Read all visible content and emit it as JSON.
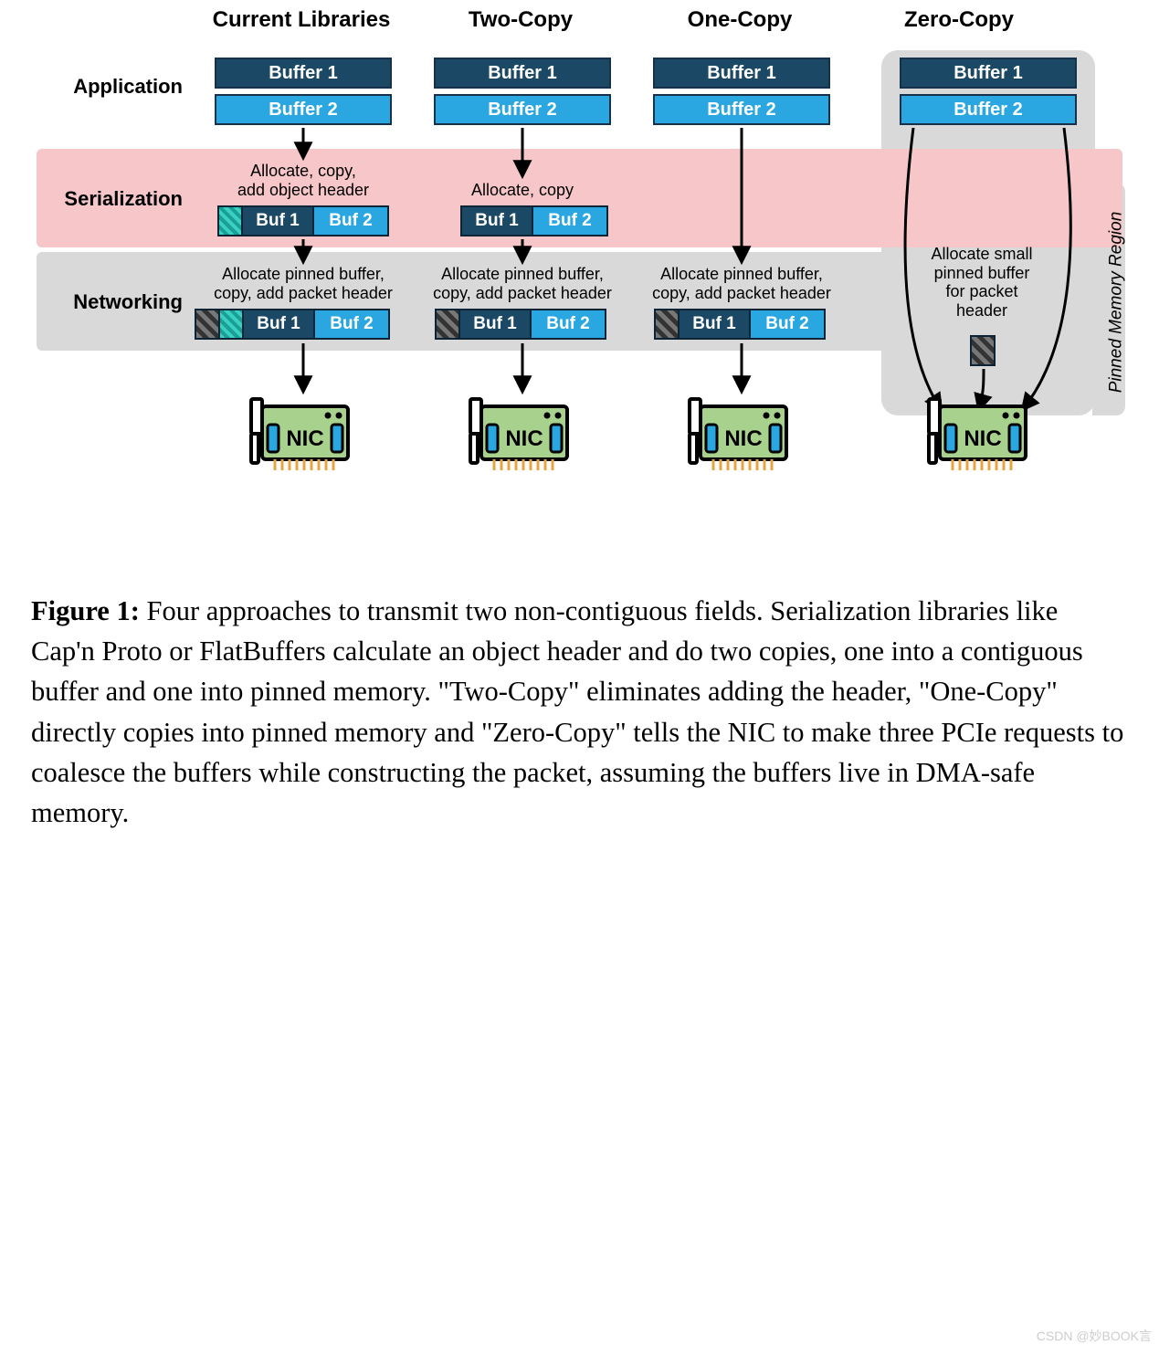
{
  "columns": {
    "c1": "Current Libraries",
    "c2": "Two-Copy",
    "c3": "One-Copy",
    "c4": "Zero-Copy"
  },
  "rows": {
    "app": "Application",
    "ser": "Serialization",
    "net": "Networking"
  },
  "pinned_region_label": "Pinned Memory Region",
  "buffers": {
    "b1": "Buffer 1",
    "b2": "Buffer 2",
    "sb1": "Buf 1",
    "sb2": "Buf 2"
  },
  "ann": {
    "ser_full": "Allocate, copy,\nadd object header",
    "ser_copy": "Allocate, copy",
    "net_full": "Allocate pinned buffer,\ncopy, add packet header",
    "zero": "Allocate small\npinned buffer\nfor packet\nheader"
  },
  "nic_label": "NIC",
  "caption": {
    "lead": "Figure 1:",
    "body": " Four approaches to transmit two non-contiguous fields. Serialization libraries like Cap'n Proto or FlatBuffers calculate an object header and do two copies, one into a contiguous buffer and one into pinned memory. \"Two-Copy\" eliminates adding the header, \"One-Copy\" directly copies into pinned memory and \"Zero-Copy\" tells the NIC to make three PCIe requests to coalesce the buffers while constructing the packet, assuming the buffers live in DMA-safe memory."
  },
  "watermark": "CSDN @妙BOOK言"
}
